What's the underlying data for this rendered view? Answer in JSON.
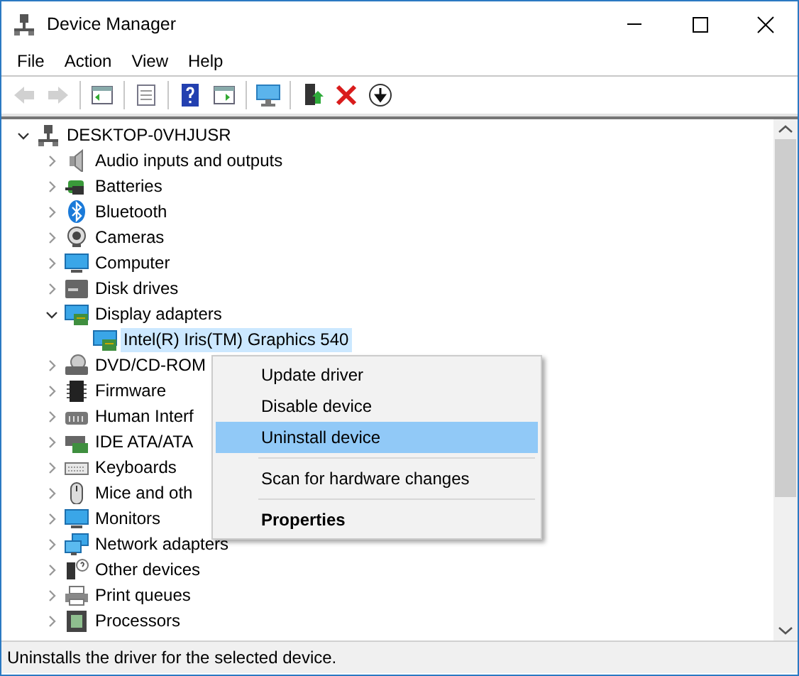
{
  "window": {
    "title": "Device Manager"
  },
  "menu_bar": [
    "File",
    "Action",
    "View",
    "Help"
  ],
  "toolbar": [
    {
      "disabled": true
    },
    {
      "disabled": true
    },
    {
      "disabled": false
    },
    {
      "disabled": false
    },
    {
      "disabled": false
    },
    {
      "disabled": false
    },
    {
      "disabled": false
    },
    {
      "disabled": false
    },
    {
      "disabled": false
    },
    {
      "disabled": false
    }
  ],
  "tree": {
    "label": "DESKTOP-0VHJUSR",
    "expanded": true,
    "selected": false,
    "children": [
      {
        "label": "Audio inputs and outputs",
        "expanded": false,
        "selected": false
      },
      {
        "label": "Batteries",
        "expanded": false,
        "selected": false
      },
      {
        "label": "Bluetooth",
        "expanded": false,
        "selected": false
      },
      {
        "label": "Cameras",
        "expanded": false,
        "selected": false
      },
      {
        "label": "Computer",
        "expanded": false,
        "selected": false
      },
      {
        "label": "Disk drives",
        "expanded": false,
        "selected": false
      },
      {
        "label": "Display adapters",
        "expanded": true,
        "selected": false,
        "children": [
          {
            "label": "Intel(R) Iris(TM) Graphics 540",
            "selected": true
          }
        ]
      },
      {
        "label": "DVD/CD-ROM",
        "expanded": false,
        "selected": false
      },
      {
        "label": "Firmware",
        "expanded": false,
        "selected": false
      },
      {
        "label": "Human Interf",
        "expanded": false,
        "selected": false
      },
      {
        "label": "IDE ATA/ATA",
        "expanded": false,
        "selected": false
      },
      {
        "label": "Keyboards",
        "expanded": false,
        "selected": false
      },
      {
        "label": "Mice and oth",
        "expanded": false,
        "selected": false
      },
      {
        "label": "Monitors",
        "expanded": false,
        "selected": false
      },
      {
        "label": "Network adapters",
        "expanded": false,
        "selected": false
      },
      {
        "label": "Other devices",
        "expanded": false,
        "selected": false
      },
      {
        "label": "Print queues",
        "expanded": false,
        "selected": false
      },
      {
        "label": "Processors",
        "expanded": false,
        "selected": false
      }
    ]
  },
  "context_menu": [
    {
      "kind": "item",
      "label": "Update driver",
      "selected": false
    },
    {
      "kind": "item",
      "label": "Disable device",
      "selected": false
    },
    {
      "kind": "item",
      "label": "Uninstall device",
      "selected": true
    },
    {
      "kind": "separator"
    },
    {
      "kind": "item",
      "label": "Scan for hardware changes",
      "selected": false
    },
    {
      "kind": "separator"
    },
    {
      "kind": "item",
      "label": "Properties",
      "selected": false,
      "default": true
    }
  ],
  "status_bar": "Uninstalls the driver for the selected device."
}
